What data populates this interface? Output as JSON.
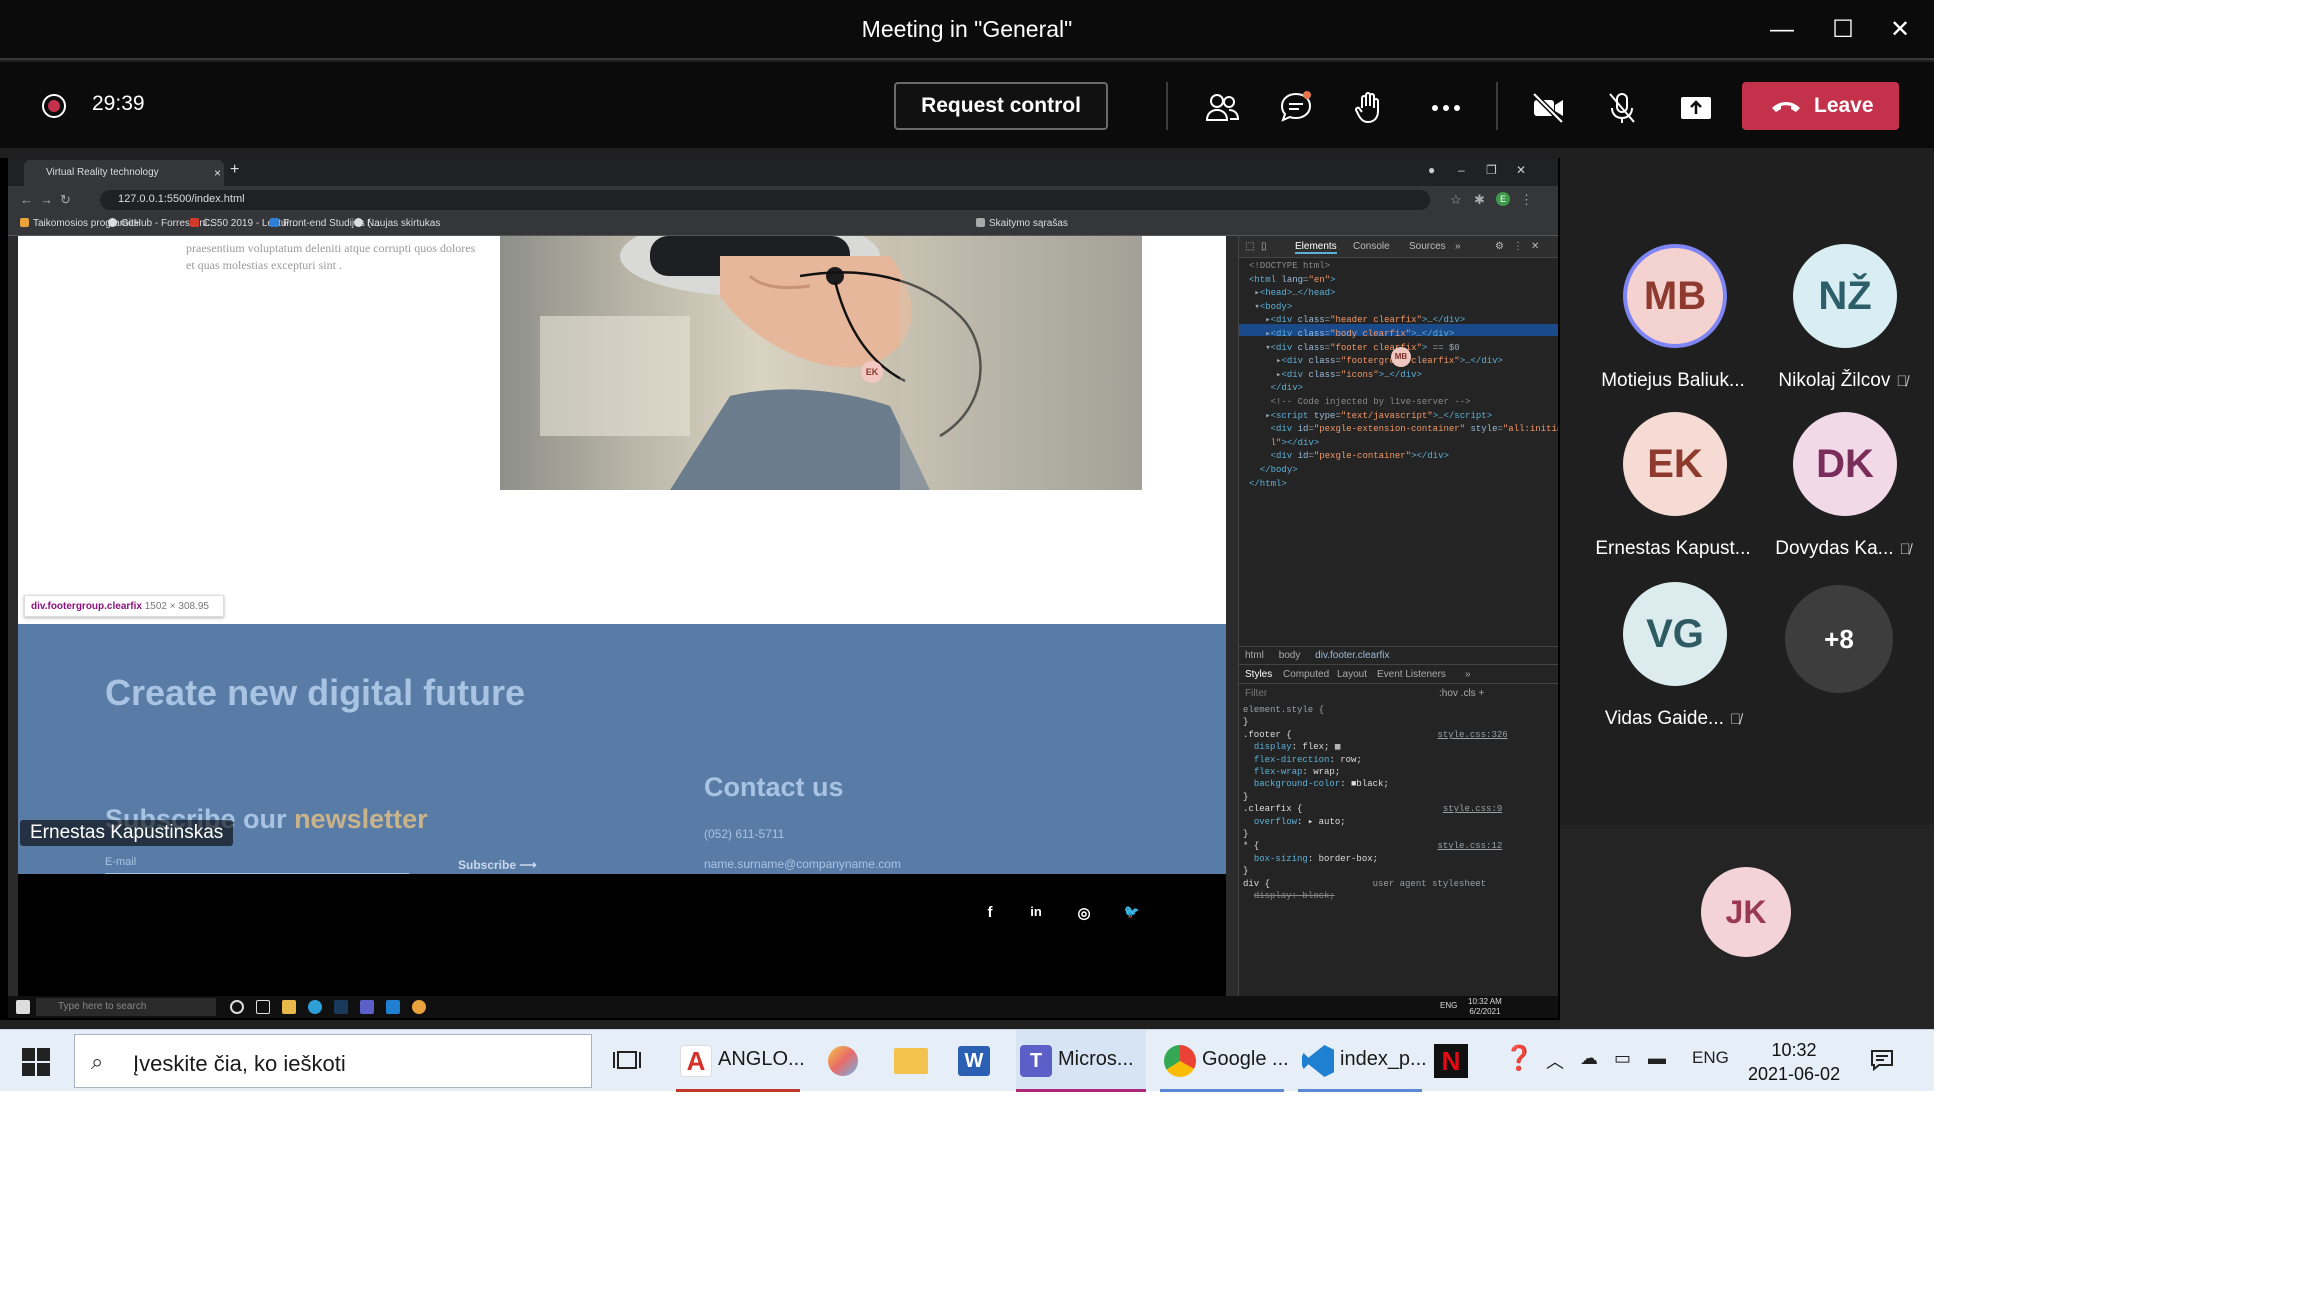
{
  "window": {
    "title": "Meeting in \"General\"",
    "minimize": "—",
    "maximize": "☐",
    "close": "✕"
  },
  "toolbar": {
    "timer": "29:39",
    "request_control": "Request control",
    "leave": "Leave"
  },
  "browser": {
    "tab_title": "Virtual Reality technology",
    "url": "127.0.0.1:5500/index.html",
    "bookmarks": [
      "Taikomosios programos",
      "GitHub - ForrestKni...",
      "CS50 2019 - Lectur...",
      "Front-end Studijos (...",
      "Naujas skirtukas",
      "Skaitymo sąrašas"
    ]
  },
  "webpage": {
    "lorem": "praesentium voluptatum deleniti atque corrupti quos dolores et quas molestias excepturi sint .",
    "tooltip_selector": "div.footergroup.clearfix",
    "tooltip_dims": "1502 × 308.95",
    "footer_title": "Create new digital future",
    "subscribe_prefix": "Subscribe our",
    "subscribe_highlight": "newsletter",
    "email_placeholder": "E-mail",
    "subscribe_button": "Subscribe",
    "contact_title": "Contact us",
    "phone": "(052) 611-5711",
    "email": "name.surname@companyname.com",
    "social": [
      "f",
      "in",
      "◎",
      "🐦"
    ]
  },
  "devtools": {
    "tabs": [
      "Elements",
      "Console",
      "Sources",
      "»"
    ],
    "breadcrumb": [
      "html",
      "body",
      "div.footer.clearfix"
    ],
    "style_tabs": [
      "Styles",
      "Computed",
      "Layout",
      "Event Listeners",
      "»"
    ],
    "filter_placeholder": "Filter",
    "filter_tools": ":hov  .cls  +"
  },
  "cursors": {
    "ek": "EK",
    "mb": "MB"
  },
  "w10": {
    "search": "Type here to search",
    "time": "10:32 AM",
    "date": "6/2/2021",
    "lang": "ENG"
  },
  "presenter": "Ernestas Kapustinskas",
  "participants": [
    {
      "initials": "MB",
      "name": "Motiejus Baliuk...",
      "muted": false,
      "speaking": true,
      "bg": "#f3d2cf",
      "fg": "#8e3a2f"
    },
    {
      "initials": "NŽ",
      "name": "Nikolaj Žilcov",
      "muted": true,
      "speaking": false,
      "bg": "#d9eef2",
      "fg": "#2c5f6a"
    },
    {
      "initials": "EK",
      "name": "Ernestas Kapust...",
      "muted": false,
      "speaking": false,
      "bg": "#f6dbd4",
      "fg": "#8e3a2f"
    },
    {
      "initials": "DK",
      "name": "Dovydas Ka...",
      "muted": true,
      "speaking": false,
      "bg": "#f1d9e8",
      "fg": "#7a2d5b"
    },
    {
      "initials": "VG",
      "name": "Vidas Gaide...",
      "muted": true,
      "speaking": false,
      "bg": "#dcecee",
      "fg": "#2e5b62"
    }
  ],
  "more_participants": "+8",
  "self_initials": "JK",
  "taskbar": {
    "search_placeholder": "Įveskite čia, ko ieškoti",
    "apps": [
      {
        "label": "ANGLO...",
        "icon": "acrobat-icon",
        "color": "#d4302a"
      },
      {
        "label": "Micros...",
        "icon": "teams-icon",
        "color": "#5b5fc7"
      },
      {
        "label": "Google ...",
        "icon": "chrome-icon",
        "color": "#34a853"
      },
      {
        "label": "index_p...",
        "icon": "vscode-icon",
        "color": "#1f7fd0"
      }
    ],
    "lang": "ENG",
    "time": "10:32",
    "date": "2021-06-02"
  }
}
